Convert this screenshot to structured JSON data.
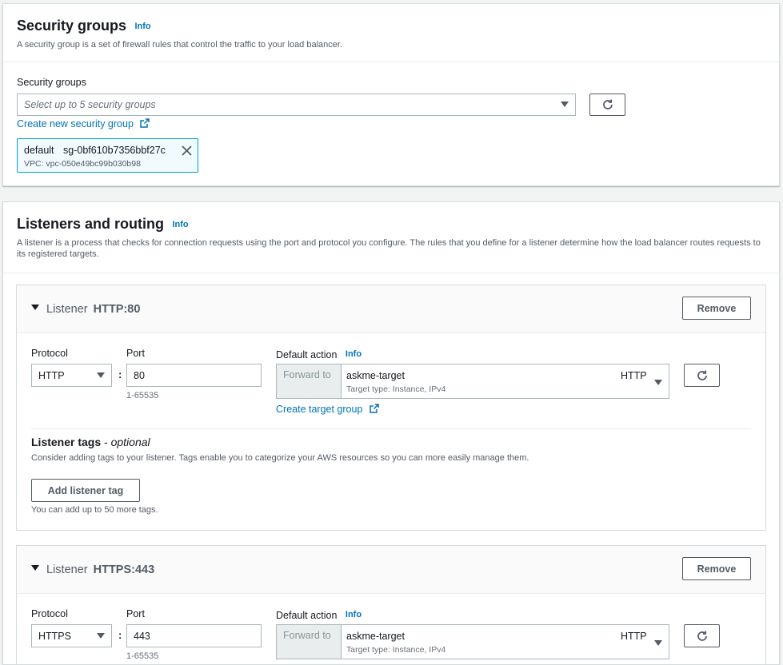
{
  "security": {
    "title": "Security groups",
    "info": "Info",
    "description": "A security group is a set of firewall rules that control the traffic to your load balancer.",
    "field_label": "Security groups",
    "placeholder": "Select up to 5 security groups",
    "create_link": "Create new security group",
    "token": {
      "name": "default",
      "id": "sg-0bf610b7356bbf27c",
      "vpc": "VPC: vpc-050e49bc99b030b98"
    }
  },
  "listeners_section": {
    "title": "Listeners and routing",
    "info": "Info",
    "description": "A listener is a process that checks for connection requests using the port and protocol you configure. The rules that you define for a listener determine how the load balancer routes requests to its registered targets."
  },
  "listeners": [
    {
      "prefix": "Listener",
      "name": "HTTP:80",
      "remove_label": "Remove",
      "protocol_label": "Protocol",
      "protocol_value": "HTTP",
      "port_label": "Port",
      "port_value": "80",
      "port_hint": "1-65535",
      "default_action_label": "Default action",
      "info": "Info",
      "forward_to": "Forward to",
      "target_name": "askme-target",
      "target_protocol": "HTTP",
      "target_type": "Target type: Instance, IPv4",
      "create_target_link": "Create target group",
      "tags_title": "Listener tags",
      "tags_optional": "optional",
      "tags_desc": "Consider adding tags to your listener. Tags enable you to categorize your AWS resources so you can more easily manage them.",
      "add_tag_label": "Add listener tag",
      "tags_hint": "You can add up to 50 more tags."
    },
    {
      "prefix": "Listener",
      "name": "HTTPS:443",
      "remove_label": "Remove",
      "protocol_label": "Protocol",
      "protocol_value": "HTTPS",
      "port_label": "Port",
      "port_value": "443",
      "port_hint": "1-65535",
      "default_action_label": "Default action",
      "info": "Info",
      "forward_to": "Forward to",
      "target_name": "askme-target",
      "target_protocol": "HTTP",
      "target_type": "Target type: Instance, IPv4"
    }
  ],
  "colon": ":",
  "dash_sep": " - ",
  "colors": {
    "link": "#0073bb",
    "token_bg": "#f1faff",
    "token_border": "#00a1c9"
  }
}
